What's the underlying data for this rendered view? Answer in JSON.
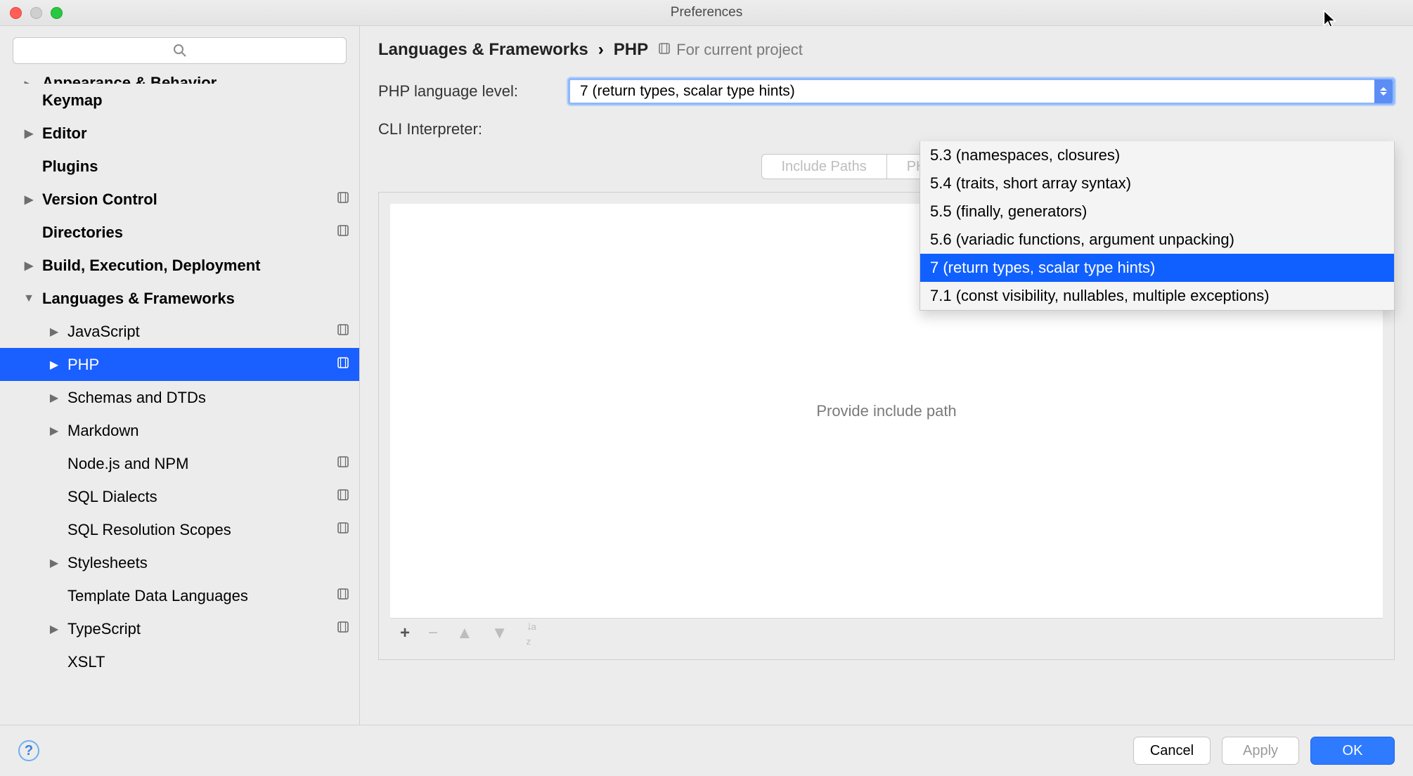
{
  "window": {
    "title": "Preferences"
  },
  "search": {
    "placeholder": ""
  },
  "sidebar": {
    "items": [
      {
        "label": "Appearance & Behavior",
        "level": 1,
        "arrow": "right",
        "proj": false,
        "clippedTop": true
      },
      {
        "label": "Keymap",
        "level": 1,
        "arrow": "",
        "proj": false
      },
      {
        "label": "Editor",
        "level": 1,
        "arrow": "right",
        "proj": false
      },
      {
        "label": "Plugins",
        "level": 1,
        "arrow": "",
        "proj": false
      },
      {
        "label": "Version Control",
        "level": 1,
        "arrow": "right",
        "proj": true
      },
      {
        "label": "Directories",
        "level": 1,
        "arrow": "",
        "proj": true
      },
      {
        "label": "Build, Execution, Deployment",
        "level": 1,
        "arrow": "right",
        "proj": false
      },
      {
        "label": "Languages & Frameworks",
        "level": 1,
        "arrow": "down",
        "proj": false
      },
      {
        "label": "JavaScript",
        "level": 2,
        "arrow": "right",
        "proj": true
      },
      {
        "label": "PHP",
        "level": 2,
        "arrow": "right",
        "proj": true,
        "selected": true
      },
      {
        "label": "Schemas and DTDs",
        "level": 2,
        "arrow": "right",
        "proj": false
      },
      {
        "label": "Markdown",
        "level": 2,
        "arrow": "right",
        "proj": false
      },
      {
        "label": "Node.js and NPM",
        "level": 2,
        "arrow": "",
        "proj": true
      },
      {
        "label": "SQL Dialects",
        "level": 2,
        "arrow": "",
        "proj": true
      },
      {
        "label": "SQL Resolution Scopes",
        "level": 2,
        "arrow": "",
        "proj": true
      },
      {
        "label": "Stylesheets",
        "level": 2,
        "arrow": "right",
        "proj": false
      },
      {
        "label": "Template Data Languages",
        "level": 2,
        "arrow": "",
        "proj": true
      },
      {
        "label": "TypeScript",
        "level": 2,
        "arrow": "right",
        "proj": true
      },
      {
        "label": "XSLT",
        "level": 2,
        "arrow": "",
        "proj": false
      }
    ]
  },
  "breadcrumb": {
    "parent": "Languages & Frameworks",
    "sep": "›",
    "current": "PHP",
    "scope": "For current project"
  },
  "form": {
    "langLevelLabel": "PHP language level:",
    "langLevelValue": "7 (return types, scalar type hints)",
    "cliLabel": "CLI Interpreter:"
  },
  "dropdown": {
    "options": [
      "5.3 (namespaces, closures)",
      "5.4 (traits, short array syntax)",
      "5.5 (finally, generators)",
      "5.6 (variadic functions, argument unpacking)",
      "7 (return types, scalar type hints)",
      "7.1 (const visibility, nullables, multiple exceptions)"
    ],
    "selectedIndex": 4
  },
  "tabs": {
    "includePaths": "Include Paths",
    "phpRuntime": "PHP Runtime"
  },
  "includePanel": {
    "placeholder": "Provide include path"
  },
  "footer": {
    "cancel": "Cancel",
    "apply": "Apply",
    "ok": "OK"
  }
}
